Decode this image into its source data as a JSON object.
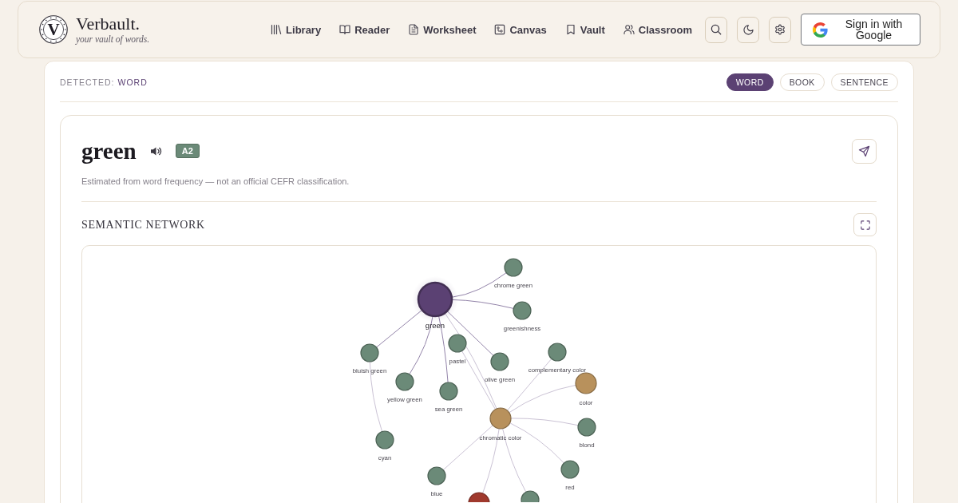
{
  "header": {
    "logo_letter": "V",
    "brand": "Verbault.",
    "tagline": "your vault of words.",
    "nav": [
      {
        "label": "Library"
      },
      {
        "label": "Reader"
      },
      {
        "label": "Worksheet"
      },
      {
        "label": "Canvas"
      },
      {
        "label": "Vault"
      },
      {
        "label": "Classroom"
      }
    ],
    "sign_in": "Sign in with Google"
  },
  "mode": {
    "label": "DETECTED:",
    "value": "WORD",
    "options": [
      {
        "label": "WORD",
        "selected": true
      },
      {
        "label": "BOOK",
        "selected": false
      },
      {
        "label": "SENTENCE",
        "selected": false
      }
    ]
  },
  "entry": {
    "word": "green",
    "level": "A2",
    "note": "Estimated from word frequency — not an official CEFR classification."
  },
  "network": {
    "title": "SEMANTIC NETWORK",
    "graph": {
      "label": "green",
      "kind": "root",
      "color": "#5b4173",
      "children": [
        {
          "label": "chrome green",
          "kind": "leaf",
          "color": "#6b8a78"
        },
        {
          "label": "greenishness",
          "kind": "leaf",
          "color": "#6b8a78"
        },
        {
          "label": "bluish green",
          "kind": "leaf",
          "color": "#6b8a78",
          "children": [
            {
              "label": "cyan",
              "kind": "leaf",
              "color": "#6b8a78"
            }
          ]
        },
        {
          "label": "yellow green",
          "kind": "leaf",
          "color": "#6b8a78"
        },
        {
          "label": "sea green",
          "kind": "leaf",
          "color": "#6b8a78"
        },
        {
          "label": "olive green",
          "kind": "leaf",
          "color": "#6b8a78"
        },
        {
          "label": "chromatic color",
          "kind": "hub",
          "color": "#b8915c",
          "children": [
            {
              "label": "pastel",
              "kind": "leaf",
              "color": "#6b8a78"
            },
            {
              "label": "complementary color",
              "kind": "leaf",
              "color": "#6b8a78"
            },
            {
              "label": "color",
              "kind": "hub",
              "color": "#b8915c"
            },
            {
              "label": "blond",
              "kind": "leaf",
              "color": "#6b8a78"
            },
            {
              "label": "red",
              "kind": "leaf",
              "color": "#6b8a78"
            },
            {
              "label": "blue",
              "kind": "leaf",
              "color": "#6b8a78"
            },
            {
              "kind": "hub",
              "color": "#a0392d"
            },
            {
              "kind": "leaf",
              "color": "#6b8a78"
            }
          ]
        }
      ]
    }
  }
}
